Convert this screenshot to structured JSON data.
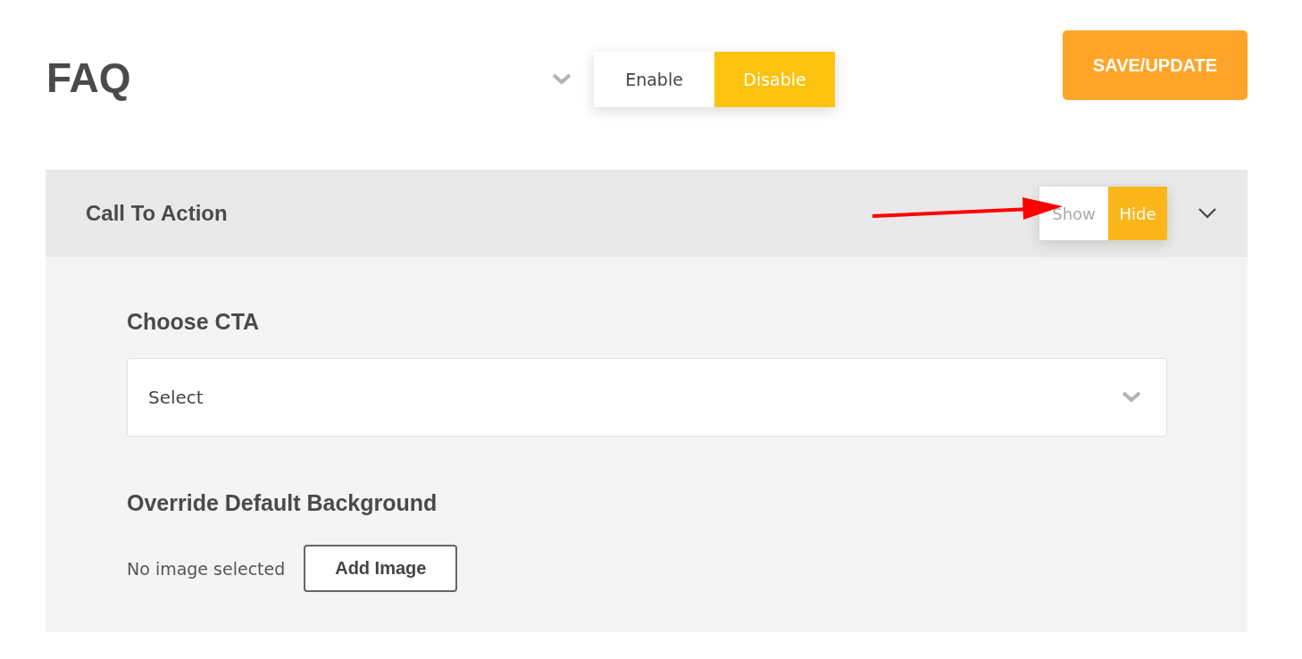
{
  "page_title": "FAQ",
  "status_toggle": [
    {
      "label": "Enable",
      "selected": false
    },
    {
      "label": "Disable",
      "selected": true
    }
  ],
  "save_button": "SAVE/UPDATE",
  "section": {
    "title": "Call To Action",
    "expanded": true,
    "visibility_toggle": [
      {
        "label": "Show",
        "selected": false
      },
      {
        "label": "Hide",
        "selected": true
      }
    ],
    "cta_label": "Choose CTA",
    "cta_select": "Select",
    "background_label": "Override Default Background",
    "image_status": "No image selected",
    "add_image_button": "Add Image"
  }
}
